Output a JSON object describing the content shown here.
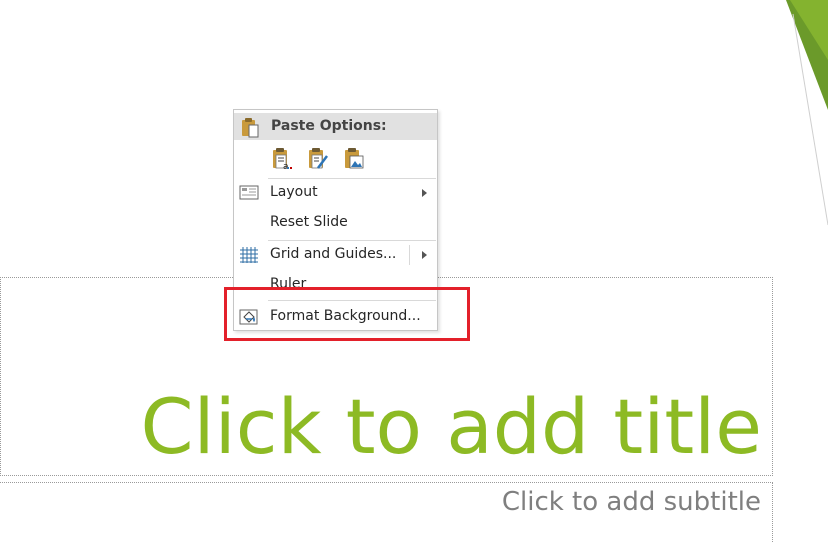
{
  "slide": {
    "title_placeholder": "Click to add title",
    "subtitle_placeholder": "Click to add subtitle",
    "accent_color": "#8dba24"
  },
  "context_menu": {
    "paste_header": "Paste Options:",
    "paste_buttons": [
      {
        "name": "use-destination-theme",
        "icon": "clipboard-text-icon"
      },
      {
        "name": "keep-source-formatting",
        "icon": "clipboard-brush-icon"
      },
      {
        "name": "picture",
        "icon": "clipboard-picture-icon"
      }
    ],
    "items": [
      {
        "label": "Layout",
        "icon": "layout-icon",
        "submenu": true
      },
      {
        "label": "Reset Slide",
        "icon": "",
        "submenu": false
      },
      {
        "label": "Grid and Guides...",
        "icon": "grid-icon",
        "submenu": true
      },
      {
        "label": "Ruler",
        "icon": "",
        "submenu": false
      },
      {
        "label": "Format Background...",
        "icon": "format-background-icon",
        "submenu": false
      }
    ]
  },
  "highlight_color": "#e3202a"
}
